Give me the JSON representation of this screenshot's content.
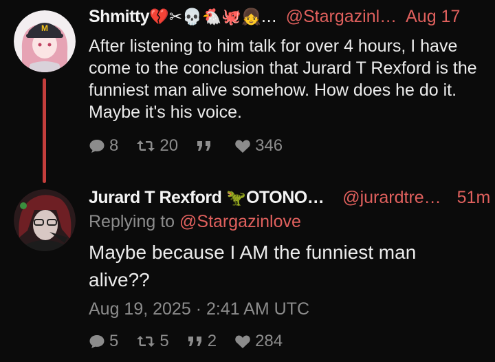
{
  "post1": {
    "author_name": "Shmitty",
    "author_emojis": "💔✂💀🐔🐙👧…",
    "handle": "@Stargazinl…",
    "time": "Aug 17",
    "text": "After listening to him talk for over 4 hours, I have come to the conclusion that Jurard T Rexford is the funniest man alive somehow. How does he do it. Maybe it's his voice.",
    "replies": "8",
    "reposts": "20",
    "quotes": "",
    "likes": "346"
  },
  "post2": {
    "author_name": "Jurard T Rexford",
    "author_emoji": "🦖",
    "author_suffix": "OTONO…",
    "handle": "@jurardtre…",
    "time": "51m",
    "replying_prefix": "Replying to",
    "replying_to": "@Stargazinlove",
    "text": "Maybe because I AM the funniest man alive??",
    "timestamp": "Aug 19, 2025 · 2:41 AM UTC",
    "replies": "5",
    "reposts": "5",
    "quotes": "2",
    "likes": "284"
  },
  "colors": {
    "accent": "#e0605d",
    "thread_line": "#c43e3c",
    "muted": "#8c8c8c",
    "background": "#0b0b0b"
  },
  "icons": [
    "reply-icon",
    "repost-icon",
    "quote-icon",
    "like-icon"
  ]
}
